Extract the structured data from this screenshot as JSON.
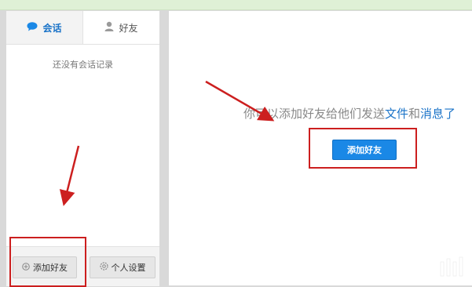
{
  "sidebar": {
    "tabs": [
      {
        "label": "会话",
        "icon": "chat-bubble-icon",
        "active": true
      },
      {
        "label": "好友",
        "icon": "user-icon",
        "active": false
      }
    ],
    "empty_message": "还没有会话记录",
    "bottom": {
      "add_friend_label": "添加好友",
      "settings_label": "个人设置"
    }
  },
  "main": {
    "message_before": "你可以添加好友给他们发送",
    "link_files": "文件",
    "message_and": "和",
    "link_messages": "消息了",
    "add_friend_button": "添加好友"
  },
  "colors": {
    "accent": "#1a88e6",
    "link": "#1a73c8",
    "annotation": "#cc1f1f"
  }
}
